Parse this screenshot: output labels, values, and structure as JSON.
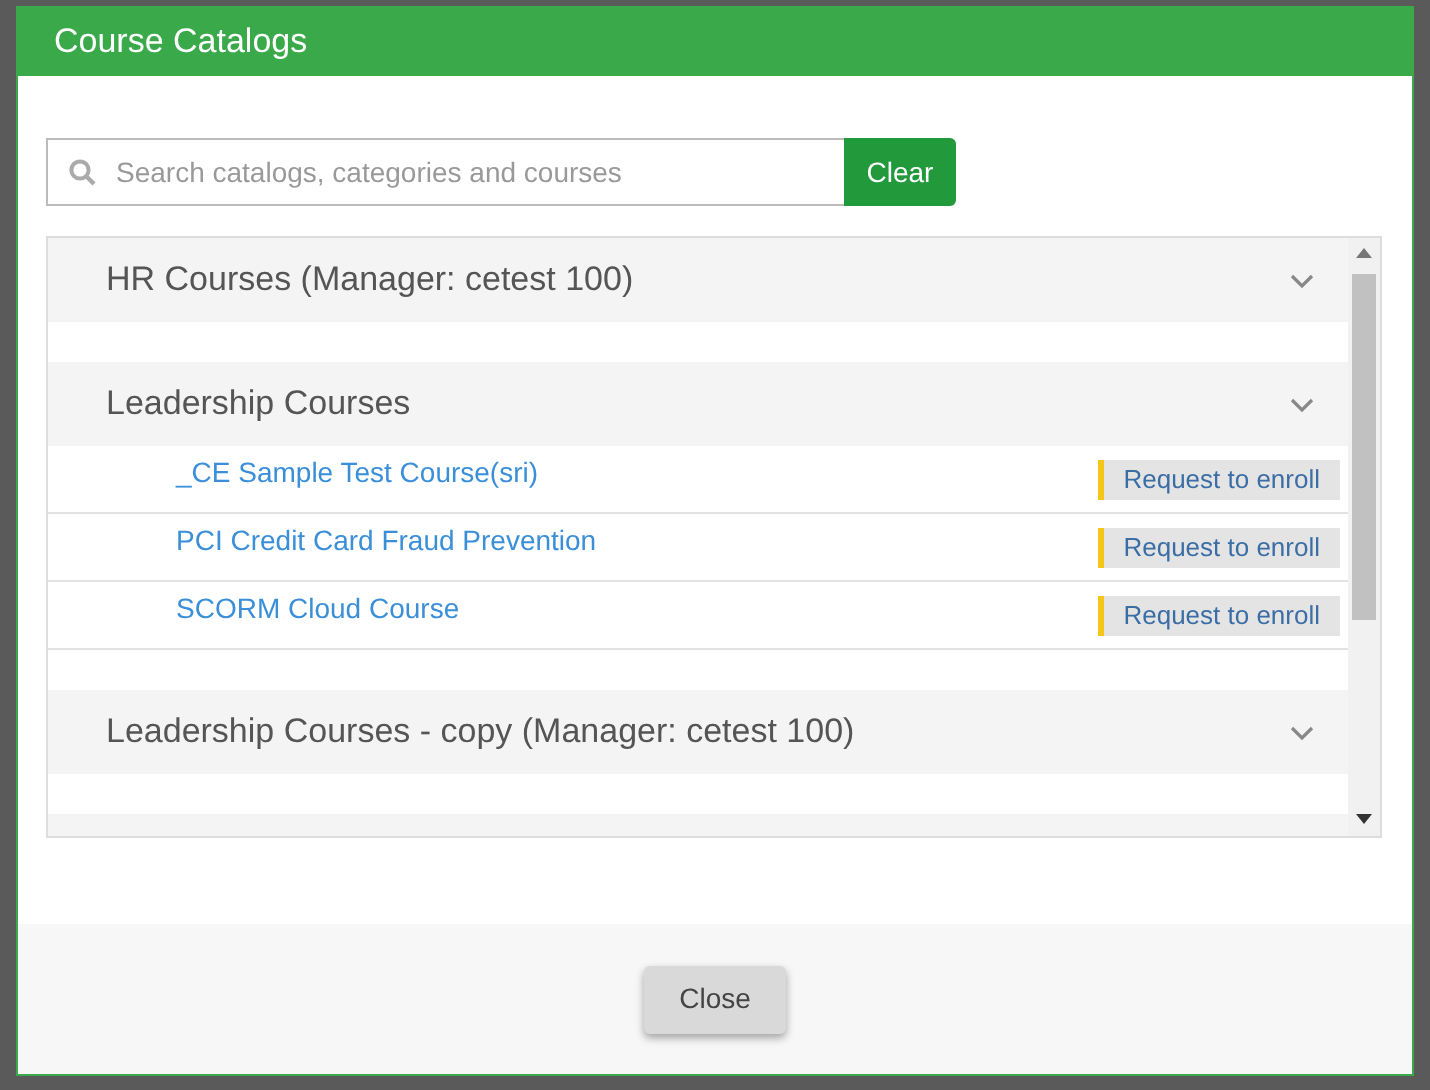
{
  "dialog": {
    "title": "Course Catalogs"
  },
  "search": {
    "placeholder": "Search catalogs, categories and courses",
    "clear_label": "Clear"
  },
  "catalogs": [
    {
      "title": "HR Courses (Manager: cetest 100)"
    },
    {
      "title": "Leadership Courses",
      "courses": [
        {
          "name": "_CE Sample Test Course(sri)",
          "action": "Request to enroll"
        },
        {
          "name": "PCI Credit Card Fraud Prevention",
          "action": "Request to enroll"
        },
        {
          "name": "SCORM Cloud Course",
          "action": "Request to enroll"
        }
      ]
    },
    {
      "title": "Leadership Courses - copy (Manager: cetest 100)"
    }
  ],
  "footer": {
    "close_label": "Close"
  }
}
